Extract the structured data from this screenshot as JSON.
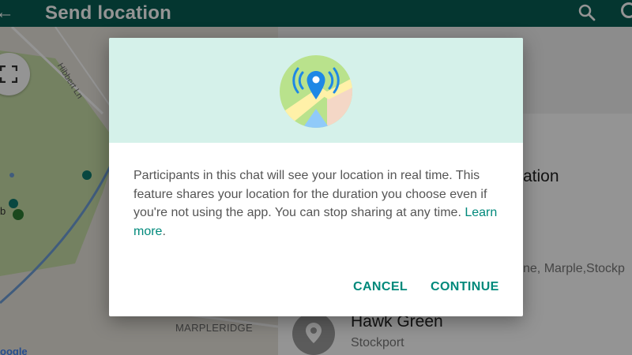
{
  "appbar": {
    "title": "Send location",
    "back_icon": "arrow-back-icon",
    "search_icon": "search-icon",
    "more_icon": "more-icon"
  },
  "map": {
    "street_label": "Hibbert Ln",
    "area_label": "MARPLERIDGE",
    "label_fragment": "b",
    "google_fragment": "oogle",
    "fullscreen_icon": "fullscreen-icon"
  },
  "list": {
    "title_fragment": "ation",
    "address_fragment": "ne, Marple,Stockp",
    "place": {
      "name": "Hawk Green",
      "subtitle": "Stockport"
    }
  },
  "dialog": {
    "banner_icon": "live-location-icon",
    "message": "Participants in this chat will see your location in real time. This feature shares your location for the duration you choose even if you're not using the app. You can stop sharing at any time.",
    "link_text": "Learn more",
    "link_suffix": ".",
    "cancel_label": "CANCEL",
    "continue_label": "CONTINUE"
  },
  "colors": {
    "appbar": "#075e54",
    "accent": "#00897b",
    "banner": "#d5f1ea",
    "map_park": "#c8dfa8",
    "map_river": "#6f9fd8",
    "pin": "#1e88e5"
  }
}
